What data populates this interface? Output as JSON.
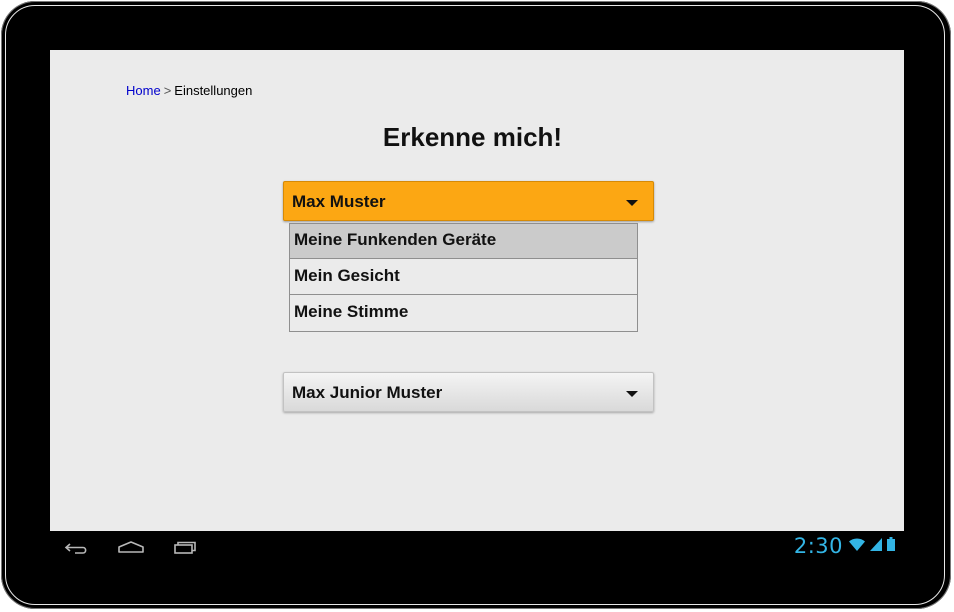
{
  "breadcrumb": {
    "home": "Home",
    "separator": ">",
    "current": "Einstellungen"
  },
  "page": {
    "title": "Erkenne mich!"
  },
  "users": [
    {
      "name": "Max Muster",
      "expanded": true,
      "options": [
        {
          "label": "Meine Funkenden Geräte",
          "selected": true
        },
        {
          "label": "Mein Gesicht",
          "selected": false
        },
        {
          "label": "Meine Stimme",
          "selected": false
        }
      ]
    },
    {
      "name": "Max Junior Muster",
      "expanded": false
    }
  ],
  "system_bar": {
    "clock": "2:30",
    "icons": [
      "back-icon",
      "home-icon",
      "recent-apps-icon",
      "wifi-icon",
      "signal-icon",
      "battery-icon"
    ]
  },
  "colors": {
    "accent_active": "#fca713",
    "screen_background": "#ebebeb",
    "clock_color": "#33b5e5",
    "link_color": "#0000cc"
  }
}
